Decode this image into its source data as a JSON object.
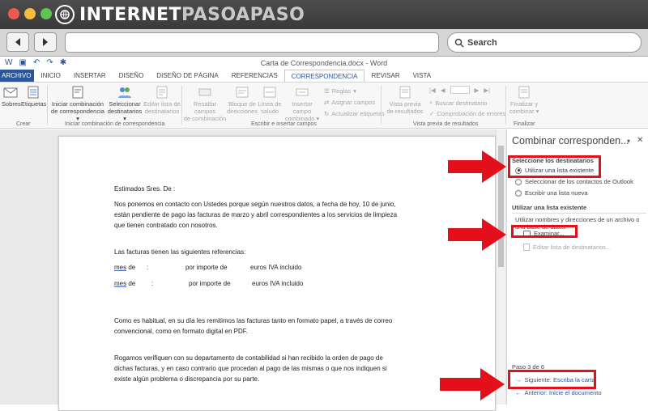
{
  "browser": {
    "logo_main": "INTERNET",
    "logo_accent": "PASOAPASO",
    "search_label": "Search",
    "traffic_colors": [
      "#ee5a52",
      "#f4bd3b",
      "#5fc453"
    ]
  },
  "window": {
    "title": "Carta de Correspondencia.docx - Word"
  },
  "tabs": [
    "ARCHIVO",
    "INICIO",
    "INSERTAR",
    "DISEÑO",
    "DISEÑO DE PÁGINA",
    "REFERENCIAS",
    "CORRESPONDENCIA",
    "REVISAR",
    "VISTA"
  ],
  "active_tab": "CORRESPONDENCIA",
  "ribbon": {
    "crear": {
      "sobres": "Sobres",
      "etiquetas": "Etiquetas",
      "label": "Crear"
    },
    "iniciar": {
      "btn1": [
        "Iniciar combinación",
        "de correspondencia"
      ],
      "btn2": [
        "Seleccionar",
        "destinatarios"
      ],
      "btn3": [
        "Editar lista de",
        "destinatarios"
      ],
      "label": "Iniciar combinación de correspondencia"
    },
    "escribir": {
      "btn1": [
        "Resaltar campos",
        "de combinación"
      ],
      "btn2": [
        "Bloque de",
        "direcciones"
      ],
      "btn3": [
        "Línea de",
        "saludo"
      ],
      "btn4": [
        "Insertar campo",
        "combinado"
      ],
      "small": [
        "Reglas",
        "Asignar campos",
        "Actualizar etiquetas"
      ],
      "label": "Escribir e insertar campos"
    },
    "vista": {
      "btn1": [
        "Vista previa",
        "de resultados"
      ],
      "small": [
        "Buscar destinatario",
        "Comprobación de errores"
      ],
      "label": "Vista previa de resultados"
    },
    "finalizar": {
      "btn1": [
        "Finalizar y",
        "combinar"
      ],
      "label": "Finalizar"
    }
  },
  "document": {
    "greeting": "Estimados Sres. De   :",
    "para1": "Nos ponemos en contacto con Ustedes porque según nuestros datos, a fecha de hoy, 10 de junio, están pendiente de pago las facturas de marzo y abril correspondientes a los servicios de limpieza que tienen contratado con nosotros.",
    "para2": "Las facturas tienen las siguientes referencias:",
    "line1": {
      "mes": "mes",
      "de": " de",
      "colon": ":",
      "importe": "por importe de",
      "euros": "euros IVA incluido"
    },
    "line2": {
      "mes": "mes",
      "de": " de",
      "colon": ":",
      "importe": "por importe de",
      "euros": "euros IVA incluido"
    },
    "para3": "Como es habitual, en su día les remitimos las facturas tanto en formato papel, a través de correo convencional, como en formato digital en PDF.",
    "para4": "Rogamos verifiquen con su departamento de contabilidad si han recibido la orden de pago de dichas facturas, y en caso contrario que procedan al pago de las mismas o que nos indiquen si existe algún problema o discrepancia por su parte."
  },
  "pane": {
    "title": "Combinar corresponden...",
    "section1": "Seleccione los destinatarios",
    "opt1": "Utilizar una lista existente",
    "opt2": "Seleccionar de los contactos de Outlook",
    "opt3": "Escribir una lista nueva",
    "section2": "Utilizar una lista existente",
    "desc": [
      "Utilizar nombres y direcciones de un archivo o",
      "una base de datos."
    ],
    "examinar": "Examinar...",
    "editar": "Editar lista de destinatarios...",
    "step": "Paso 3 de 6",
    "next": "Siguiente: Escriba la carta",
    "prev": "Anterior: Inicie el documento"
  }
}
